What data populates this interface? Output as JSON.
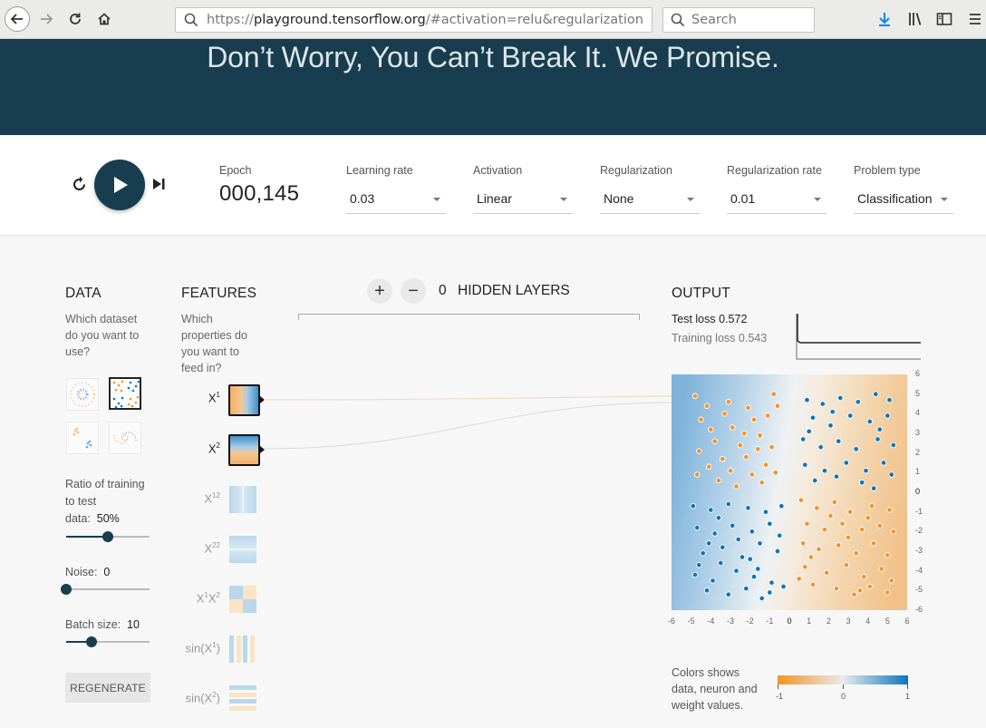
{
  "browser": {
    "url_scheme": "https://",
    "url_host": "playground.tensorflow.org",
    "url_rest": "/#activation=relu&regularization",
    "search_placeholder": "Search"
  },
  "header": {
    "title": "Don’t Worry, You Can’t Break It. We Promise."
  },
  "controls": {
    "epoch_label": "Epoch",
    "epoch_value": "000,145",
    "learning_rate": {
      "label": "Learning rate",
      "value": "0.03"
    },
    "activation": {
      "label": "Activation",
      "value": "Linear"
    },
    "regularization": {
      "label": "Regularization",
      "value": "None"
    },
    "regularization_rate": {
      "label": "Regularization rate",
      "value": "0.01"
    },
    "problem_type": {
      "label": "Problem type",
      "value": "Classification"
    }
  },
  "data_panel": {
    "title": "DATA",
    "question": [
      "Which dataset",
      "do you want to",
      "use?"
    ],
    "ratio_label": [
      "Ratio of training",
      "to test"
    ],
    "ratio_prefix": "data:",
    "ratio_value": "50%",
    "ratio_fraction": 0.5,
    "noise_label": "Noise:",
    "noise_value": "0",
    "noise_fraction": 0.0,
    "batch_label": "Batch size:",
    "batch_value": "10",
    "batch_fraction": 0.3,
    "regenerate_label": "REGENERATE"
  },
  "features_panel": {
    "title": "FEATURES",
    "question": [
      "Which",
      "properties do",
      "you want to",
      "feed in?"
    ],
    "features": [
      {
        "base": "X",
        "sup": "1",
        "tail": "",
        "active": true
      },
      {
        "base": "X",
        "sup": "2",
        "tail": "",
        "active": true
      },
      {
        "base": "X",
        "sup": "1",
        "tail": "2",
        "active": false
      },
      {
        "base": "X",
        "sup": "2",
        "tail": "2",
        "active": false
      },
      {
        "base": "X",
        "sup": "1",
        "tail": "X",
        "sup2": "2",
        "active": false
      },
      {
        "base": "sin(X",
        "sup": "1",
        "tail": ")",
        "active": false
      },
      {
        "base": "sin(X",
        "sup": "2",
        "tail": ")",
        "active": false
      }
    ]
  },
  "network": {
    "add_label": "+",
    "remove_label": "−",
    "hidden_layers_count": "0",
    "hidden_layers_label": "HIDDEN LAYERS"
  },
  "output_panel": {
    "title": "OUTPUT",
    "test_loss_label": "Test loss",
    "test_loss_value": "0.572",
    "training_loss_label": "Training loss",
    "training_loss_value": "0.543",
    "legend_text": [
      "Colors shows",
      "data, neuron and",
      "weight values."
    ],
    "colorbar_labels": [
      "-1",
      "0",
      "1"
    ],
    "colors": {
      "positive": "#0877bd",
      "negative": "#f59322",
      "neutral": "#e8eaeb"
    }
  },
  "chart_data": {
    "type": "scatter",
    "title": "",
    "xlabel": "",
    "ylabel": "",
    "xlim": [
      -6,
      6
    ],
    "ylim": [
      -6,
      6
    ],
    "x_ticks": [
      "-6",
      "-5",
      "-4",
      "-3",
      "-2",
      "-1",
      "0",
      "1",
      "2",
      "3",
      "4",
      "5",
      "6"
    ],
    "y_ticks": [
      "6",
      "5",
      "4",
      "3",
      "2",
      "1",
      "0",
      "-1",
      "-2",
      "-3",
      "-4",
      "-5",
      "-6"
    ],
    "series": [
      {
        "color": "#f59322",
        "points": [
          [
            -4.8,
            4.9
          ],
          [
            -4.2,
            4.4
          ],
          [
            -3.1,
            4.6
          ],
          [
            -4.5,
            3.7
          ],
          [
            -2.1,
            4.3
          ],
          [
            -0.8,
            5.0
          ],
          [
            -0.6,
            4.4
          ],
          [
            -4.0,
            3.2
          ],
          [
            -2.9,
            3.3
          ],
          [
            -1.8,
            3.7
          ],
          [
            -1.1,
            3.9
          ],
          [
            -3.8,
            2.6
          ],
          [
            -2.5,
            2.4
          ],
          [
            -1.5,
            2.9
          ],
          [
            -0.9,
            2.3
          ],
          [
            -4.6,
            2.1
          ],
          [
            -3.4,
            1.7
          ],
          [
            -2.2,
            1.8
          ],
          [
            -1.2,
            1.4
          ],
          [
            -0.7,
            1.0
          ],
          [
            -4.1,
            1.3
          ],
          [
            -3.0,
            1.1
          ],
          [
            -1.9,
            0.9
          ],
          [
            -3.6,
            0.6
          ],
          [
            -2.7,
            0.3
          ],
          [
            -1.4,
            0.5
          ],
          [
            -4.7,
            0.9
          ],
          [
            -2.3,
            3.0
          ],
          [
            -3.3,
            4.0
          ],
          [
            -1.6,
            2.2
          ],
          [
            0.6,
            -0.4
          ],
          [
            1.4,
            -0.8
          ],
          [
            2.3,
            -0.5
          ],
          [
            3.1,
            -1.0
          ],
          [
            4.2,
            -0.7
          ],
          [
            5.1,
            -0.9
          ],
          [
            0.9,
            -1.6
          ],
          [
            1.8,
            -1.9
          ],
          [
            2.7,
            -1.6
          ],
          [
            3.7,
            -1.9
          ],
          [
            4.6,
            -1.7
          ],
          [
            5.3,
            -2.0
          ],
          [
            0.7,
            -2.6
          ],
          [
            1.5,
            -2.9
          ],
          [
            2.5,
            -2.7
          ],
          [
            3.4,
            -3.1
          ],
          [
            4.3,
            -2.6
          ],
          [
            5.0,
            -3.2
          ],
          [
            0.8,
            -3.8
          ],
          [
            1.9,
            -4.1
          ],
          [
            2.9,
            -3.7
          ],
          [
            3.8,
            -4.3
          ],
          [
            4.7,
            -3.9
          ],
          [
            5.2,
            -4.5
          ],
          [
            1.2,
            -4.7
          ],
          [
            2.4,
            -4.9
          ],
          [
            3.3,
            -5.2
          ],
          [
            4.1,
            -4.8
          ],
          [
            5.0,
            -5.1
          ],
          [
            0.5,
            -4.4
          ],
          [
            2.1,
            -1.2
          ],
          [
            3.0,
            -2.3
          ],
          [
            4.0,
            -1.3
          ],
          [
            1.1,
            -3.3
          ],
          [
            3.6,
            -5.0
          ]
        ]
      },
      {
        "color": "#0877bd",
        "points": [
          [
            0.9,
            4.7
          ],
          [
            1.7,
            4.5
          ],
          [
            2.6,
            4.8
          ],
          [
            3.5,
            4.6
          ],
          [
            4.4,
            5.0
          ],
          [
            5.1,
            4.7
          ],
          [
            1.2,
            3.8
          ],
          [
            2.1,
            3.4
          ],
          [
            3.1,
            3.9
          ],
          [
            4.1,
            3.6
          ],
          [
            5.0,
            3.9
          ],
          [
            0.7,
            2.7
          ],
          [
            1.6,
            2.3
          ],
          [
            2.5,
            2.6
          ],
          [
            3.4,
            2.2
          ],
          [
            4.5,
            2.7
          ],
          [
            5.3,
            2.4
          ],
          [
            0.8,
            1.4
          ],
          [
            1.8,
            1.1
          ],
          [
            2.9,
            1.5
          ],
          [
            3.9,
            1.1
          ],
          [
            4.8,
            1.5
          ],
          [
            5.2,
            0.9
          ],
          [
            1.3,
            0.6
          ],
          [
            2.4,
            0.8
          ],
          [
            3.7,
            0.5
          ],
          [
            4.3,
            0.2
          ],
          [
            1.0,
            3.1
          ],
          [
            2.2,
            4.1
          ],
          [
            4.6,
            3.2
          ],
          [
            -4.9,
            -0.7
          ],
          [
            -4.0,
            -0.9
          ],
          [
            -3.1,
            -0.6
          ],
          [
            -2.1,
            -0.8
          ],
          [
            -1.2,
            -1.0
          ],
          [
            -0.4,
            -0.7
          ],
          [
            -4.7,
            -1.8
          ],
          [
            -3.8,
            -2.1
          ],
          [
            -2.9,
            -1.7
          ],
          [
            -1.9,
            -2.0
          ],
          [
            -1.0,
            -1.6
          ],
          [
            -4.4,
            -3.1
          ],
          [
            -3.4,
            -2.8
          ],
          [
            -2.4,
            -3.3
          ],
          [
            -1.5,
            -2.6
          ],
          [
            -0.6,
            -3.0
          ],
          [
            -4.8,
            -4.2
          ],
          [
            -3.9,
            -4.5
          ],
          [
            -2.7,
            -4.0
          ],
          [
            -1.8,
            -4.3
          ],
          [
            -0.9,
            -4.6
          ],
          [
            -4.2,
            -5.0
          ],
          [
            -3.1,
            -5.2
          ],
          [
            -2.2,
            -4.9
          ],
          [
            -1.0,
            -5.1
          ],
          [
            -4.6,
            -3.7
          ],
          [
            -3.5,
            -3.6
          ],
          [
            -2.0,
            -3.4
          ],
          [
            -0.5,
            -2.2
          ],
          [
            -1.4,
            -5.4
          ],
          [
            -0.3,
            -4.8
          ],
          [
            -3.6,
            -1.3
          ],
          [
            -2.6,
            -2.4
          ],
          [
            -4.1,
            -2.6
          ],
          [
            -1.6,
            -3.9
          ]
        ]
      }
    ]
  }
}
